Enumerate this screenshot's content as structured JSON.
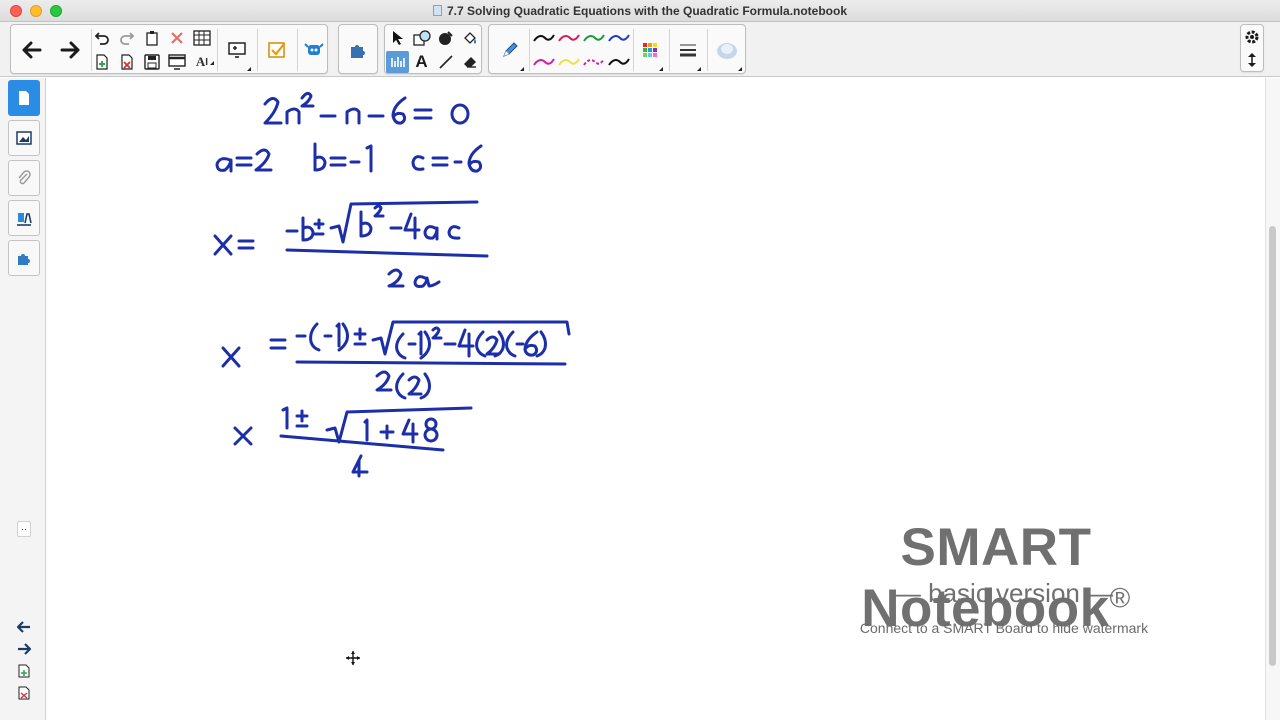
{
  "window": {
    "title": "7.7 Solving Quadratic Equations with the Quadratic Formula.notebook"
  },
  "toolbar": {
    "back": "back-arrow-icon",
    "forward": "forward-arrow-icon",
    "undo": "undo-icon",
    "redo": "redo-icon",
    "paste": "paste-icon",
    "delete": "delete-icon",
    "table": "table-icon",
    "add_page": "add-page-icon",
    "delete_page": "delete-page-icon",
    "save": "save-icon",
    "screen_shade": "screen-shade-icon",
    "text_ocr": "ai-icon",
    "display": "display-icon",
    "response": "response-icon",
    "lesson_activity": "activity-icon",
    "addons": "puzzle-icon",
    "select": "select-arrow-icon",
    "shapes": "shapes-icon",
    "fill": "fill-icon",
    "magic_pen": "magic-pen-icon",
    "measure": "measure-icon",
    "text": "A",
    "line": "line-icon",
    "eraser": "eraser-icon",
    "pen": "pen-icon",
    "pen_colors": [
      "#111111",
      "#d81e5b",
      "#1f9a3b",
      "#1c3fbf",
      "#d81ea0",
      "#f0e040",
      "#d81ea0",
      "#111111"
    ],
    "accent": "#1e6fd9"
  },
  "sidebar": {
    "tabs": [
      "page-sorter-icon",
      "gallery-icon",
      "attachments-icon",
      "properties-icon",
      "addons-icon"
    ],
    "collapse": "collapse-icon"
  },
  "canvas": {
    "ink_color": "#1c2fa8",
    "move_cursor": "move-cursor-icon"
  },
  "watermark": {
    "title": "SMART Notebook",
    "reg": "®",
    "subtitle": "— basic version —",
    "note": "Connect to a SMART Board to hide watermark"
  },
  "footer_nav": {
    "prev": "previous-page-icon",
    "next": "next-page-icon",
    "add": "add-page-icon",
    "delete": "delete-page-icon"
  }
}
